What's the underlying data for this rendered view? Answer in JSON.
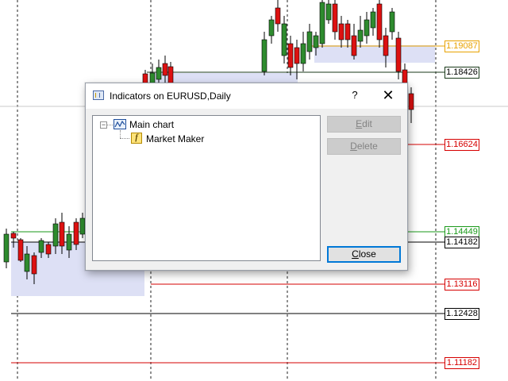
{
  "chart_background": {
    "price_levels": [
      {
        "label": "1.19087",
        "color": "#e8a200",
        "text_color": "#e8a200"
      },
      {
        "label": "1.18426",
        "color": "#1a3a1a",
        "text_color": "#000000"
      },
      {
        "label": "1.16624",
        "color": "#d60000",
        "text_color": "#d60000"
      },
      {
        "label": "1.14449",
        "color": "#1a9a1a",
        "text_color": "#1a9a1a"
      },
      {
        "label": "1.14182",
        "color": "#000000",
        "text_color": "#000000"
      },
      {
        "label": "1.13116",
        "color": "#d60000",
        "text_color": "#d60000"
      },
      {
        "label": "1.12428",
        "color": "#000000",
        "text_color": "#000000"
      },
      {
        "label": "1.11182",
        "color": "#d60000",
        "text_color": "#d60000"
      }
    ],
    "bull_color": "#2e8b2e",
    "bear_color": "#dd1111",
    "zone_color": "#dde0f5"
  },
  "dialog": {
    "title": "Indicators on EURUSD,Daily",
    "help_glyph": "?",
    "close_glyph": "✕",
    "tree": {
      "expander_glyph": "−",
      "root_label": "Main chart",
      "children": [
        {
          "label": "Market Maker",
          "icon": "indicator-f-icon"
        }
      ]
    },
    "buttons": {
      "edit": {
        "first": "E",
        "rest": "dit",
        "enabled": false
      },
      "delete": {
        "first": "D",
        "rest": "elete",
        "enabled": false
      },
      "close": {
        "first": "C",
        "rest": "lose",
        "enabled": true
      }
    }
  }
}
